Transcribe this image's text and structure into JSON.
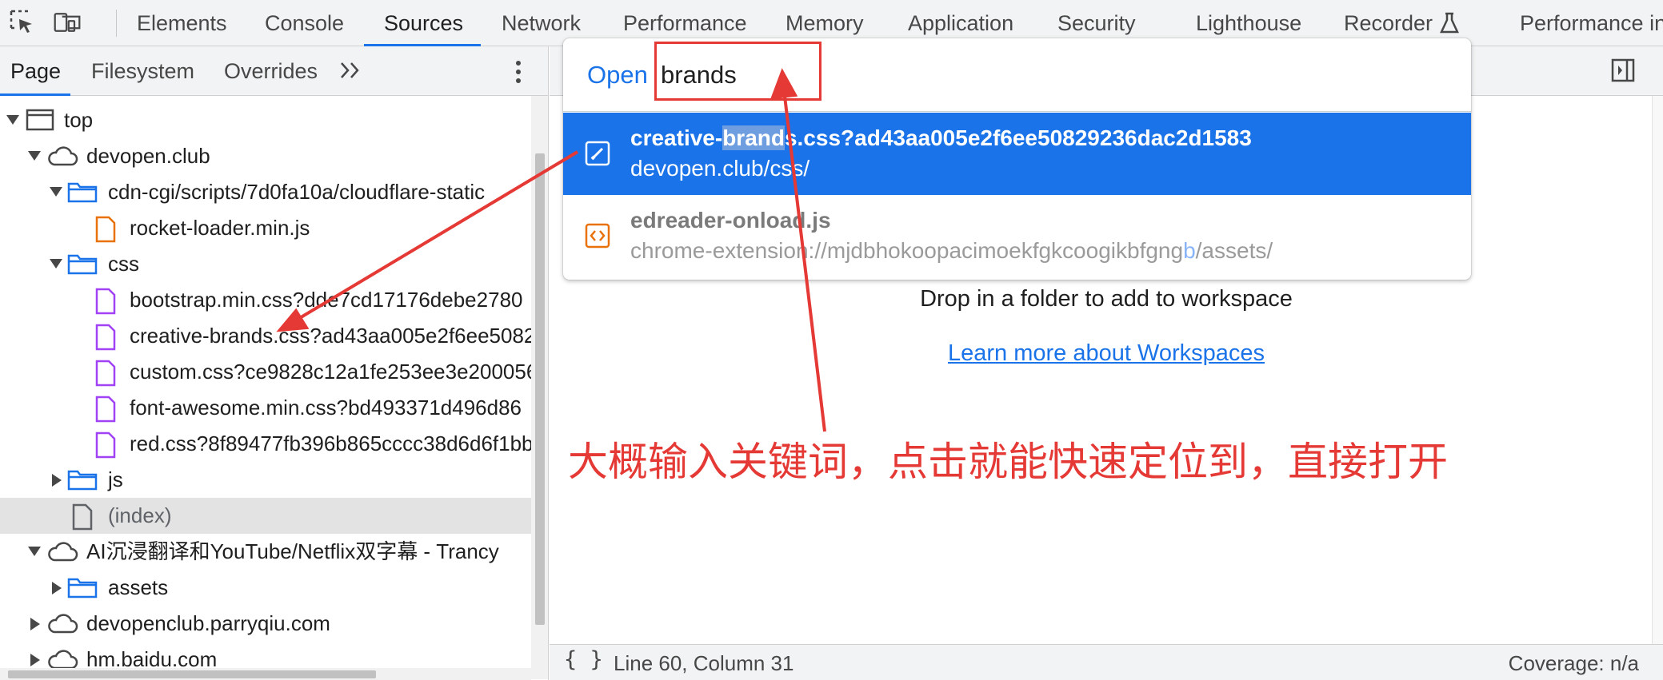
{
  "devtools": {
    "tabs": [
      "Elements",
      "Console",
      "Sources",
      "Network",
      "Performance",
      "Memory",
      "Application",
      "Security",
      "Lighthouse",
      "Recorder",
      "Performance in"
    ],
    "active_tab": "Sources"
  },
  "navigator": {
    "tabs": [
      "Page",
      "Filesystem",
      "Overrides"
    ],
    "active_tab": "Page",
    "tree": [
      {
        "label": "top",
        "kind": "frame",
        "expanded": true
      },
      {
        "label": "devopen.club",
        "kind": "domain",
        "expanded": true
      },
      {
        "label": "cdn-cgi/scripts/7d0fa10a/cloudflare-static",
        "kind": "folder",
        "expanded": true
      },
      {
        "label": "rocket-loader.min.js",
        "kind": "script"
      },
      {
        "label": "css",
        "kind": "folder",
        "expanded": true
      },
      {
        "label": "bootstrap.min.css?dde7cd17176debe2780",
        "kind": "stylesheet"
      },
      {
        "label": "creative-brands.css?ad43aa005e2f6ee5082",
        "kind": "stylesheet"
      },
      {
        "label": "custom.css?ce9828c12a1fe253ee3e200056",
        "kind": "stylesheet"
      },
      {
        "label": "font-awesome.min.css?bd493371d496d86",
        "kind": "stylesheet"
      },
      {
        "label": "red.css?8f89477fb396b865cccc38d6d6f1bb",
        "kind": "stylesheet"
      },
      {
        "label": "js",
        "kind": "folder",
        "expanded": false
      },
      {
        "label": "(index)",
        "kind": "document",
        "selected": true
      },
      {
        "label": "AI沉浸翻译和YouTube/Netflix双字幕 - Trancy",
        "kind": "domain",
        "expanded": true
      },
      {
        "label": "assets",
        "kind": "folder",
        "expanded": false
      },
      {
        "label": "devopenclub.parryqiu.com",
        "kind": "domain",
        "expanded": false
      },
      {
        "label": "hm.baidu.com",
        "kind": "domain",
        "expanded": false
      }
    ]
  },
  "quick_open": {
    "prompt": "Open",
    "query": "brands",
    "results": [
      {
        "title_pre": "creative-",
        "title_hl": "brand",
        "title_post": "s.css?ad43aa005e2f6ee50829236dac2d1583",
        "path": "devopen.club/css/",
        "icon": "stylesheet-icon",
        "active": true
      },
      {
        "title": "edreader-onload.js",
        "path_pre": "chrome-extension://mjdbhokoopacimoekfgkcoogikbfgng",
        "path_hl": "b",
        "path_post": "/assets/",
        "icon": "script-icon",
        "active": false
      }
    ]
  },
  "editor": {
    "drop_text": "Drop in a folder to add to workspace",
    "learn_link": "Learn more about Workspaces"
  },
  "status": {
    "braces": "{ }",
    "position": "Line 60, Column 31",
    "coverage": "Coverage: n/a"
  },
  "annotation": {
    "text": "大概输入关键词，点击就能快速定位到，直接打开"
  },
  "colors": {
    "accent": "#1a73e8",
    "annotation_red": "#e53935",
    "stylesheet_purple": "#a142f4",
    "script_orange": "#e8710a",
    "folder_blue": "#1a73e8"
  }
}
